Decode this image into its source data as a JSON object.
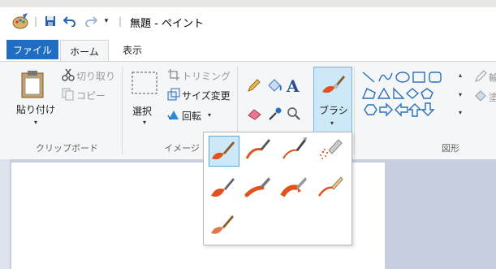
{
  "title_bar": {
    "title": "無題 - ペイント",
    "quick_access": [
      "save-icon",
      "undo-icon",
      "redo-icon",
      "customize-icon"
    ]
  },
  "tabs": {
    "file": "ファイル",
    "home": "ホーム",
    "view": "表示"
  },
  "clipboard": {
    "paste": "貼り付け",
    "cut": "切り取り",
    "copy": "コピー",
    "group": "クリップボード"
  },
  "image": {
    "select": "選択",
    "crop": "トリミング",
    "resize": "サイズ変更",
    "rotate": "回転",
    "group": "イメージ"
  },
  "tools": {
    "icons": [
      "pencil-icon",
      "fill-icon",
      "text-icon",
      "eraser-icon",
      "color-picker-icon",
      "magnifier-icon"
    ]
  },
  "brushes": {
    "label": "ブラシ",
    "items": [
      "brush",
      "calligraphy-brush-1",
      "calligraphy-brush-2",
      "airbrush",
      "oil-brush",
      "crayon",
      "marker",
      "natural-pencil",
      "watercolor-brush"
    ],
    "selected_index": 0
  },
  "shapes": {
    "group": "図形",
    "outline_partial": "輪",
    "fill_partial": "塗"
  },
  "colors": {
    "accent": "#1f6ec4",
    "brush_orange": "#e0531e",
    "canvas_bg": "#c8d0e0"
  }
}
